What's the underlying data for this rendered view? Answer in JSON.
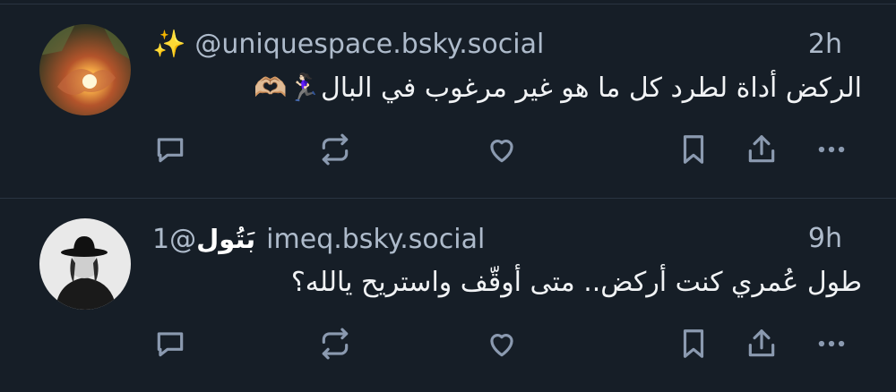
{
  "posts": [
    {
      "emoji": "✨",
      "display_name": "",
      "handle": "@uniquespace.bsky.social",
      "time": "2h",
      "text": "الركض أداة لطرد كل ما هو غير مرغوب في البال🏃🏻‍♀️🫶🏼",
      "avatar_icon": "sunlight-hands-photo"
    },
    {
      "emoji": "",
      "display_name": "بَتُول",
      "handle": "@1imeq.bsky.social",
      "time": "9h",
      "text": "طول عُمري كنت أركض.. متى أوقّف واستريح يالله؟",
      "avatar_icon": "person-with-hat-photo"
    }
  ],
  "actions": [
    "reply-icon",
    "repost-icon",
    "like-icon",
    "bookmark-icon",
    "share-icon",
    "more-icon"
  ],
  "colors": {
    "background": "#161e27",
    "icon": "#8b9ab0",
    "muted_text": "#aebbcb",
    "divider": "#2a3441"
  }
}
